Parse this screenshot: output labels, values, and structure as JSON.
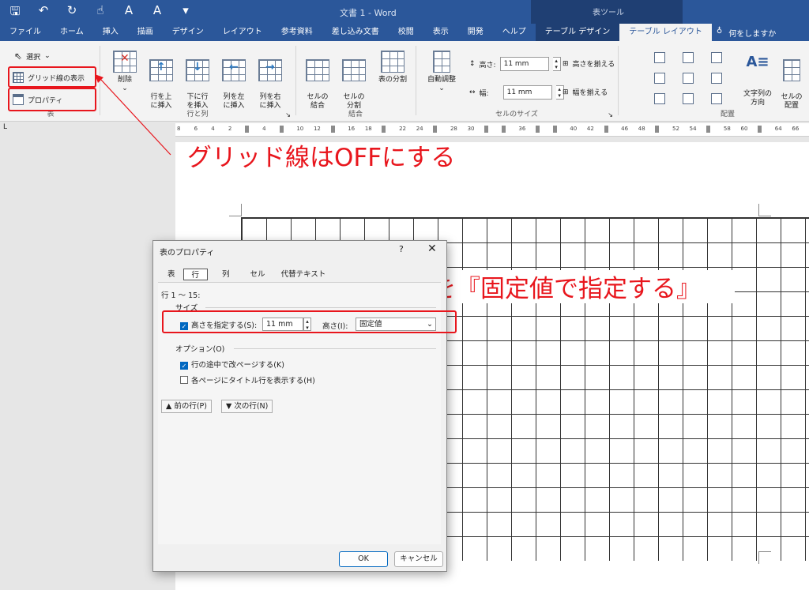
{
  "titlebar": {
    "qat": [
      "🖫",
      "↶",
      "↻",
      "☝",
      "A",
      "A",
      "▾"
    ],
    "doc_title": "文書 1  -  Word",
    "context_title": "表ツール"
  },
  "tabs": [
    {
      "label": "ファイル"
    },
    {
      "label": "ホーム"
    },
    {
      "label": "挿入"
    },
    {
      "label": "描画"
    },
    {
      "label": "デザイン"
    },
    {
      "label": "レイアウト"
    },
    {
      "label": "参考資料"
    },
    {
      "label": "差し込み文書"
    },
    {
      "label": "校閲"
    },
    {
      "label": "表示"
    },
    {
      "label": "開発"
    },
    {
      "label": "ヘルプ"
    },
    {
      "label": "テーブル デザイン"
    },
    {
      "label": "テーブル レイアウト"
    }
  ],
  "tell_me": {
    "icon": "lightbulb-icon",
    "label": "何をしますか"
  },
  "ribbon": {
    "table_group": {
      "select": "選択",
      "gridlines": "グリッド線の表示",
      "properties": "プロパティ",
      "label": "表"
    },
    "rows_cols": {
      "delete": "削除",
      "insert_above": "行を上\nに挿入",
      "insert_below": "下に行\nを挿入",
      "insert_left": "列を左\nに挿入",
      "insert_right": "列を右\nに挿入",
      "label": "行と列"
    },
    "merge": {
      "merge_cells": "セルの\n結合",
      "split_cells": "セルの\n分割",
      "split_table": "表の分割",
      "label": "結合"
    },
    "cell_size": {
      "autofit": "自動調整",
      "height_label": "高さ:",
      "height_value": "11 mm",
      "width_label": "幅:",
      "width_value": "11 mm",
      "distribute_rows": "高さを揃える",
      "distribute_cols": "幅を揃える",
      "label": "セルのサイズ"
    },
    "alignment": {
      "text_direction": "文字列の\n方向",
      "cell_margins": "セルの\n配置",
      "label": "配置"
    }
  },
  "ruler": {
    "corner": "L",
    "ticks": [
      "8",
      "6",
      "4",
      "2",
      "",
      "4",
      "",
      "10",
      "12",
      "",
      "16",
      "18",
      "",
      "22",
      "24",
      "",
      "28",
      "30",
      "",
      "",
      "36",
      "",
      "",
      "40",
      "42",
      "",
      "46",
      "48",
      "",
      "52",
      "54",
      "",
      "58",
      "60",
      "",
      "64",
      "66"
    ]
  },
  "annotations": {
    "gridlines_off": "グリッド線はOFFにする",
    "fixed_height": "高さを『固定値で指定する』"
  },
  "dialog": {
    "title": "表のプロパティ",
    "help": "?",
    "close": "✕",
    "tabs": [
      "表",
      "行",
      "列",
      "セル",
      "代替テキスト"
    ],
    "rows_range": "行 1 ～ 15:",
    "size_section": "サイズ",
    "specify_height": "高さを指定する(S):",
    "height_value": "11 mm",
    "height_rule_label": "高さ(I):",
    "height_rule_value": "固定値",
    "options_section": "オプション(O)",
    "allow_break": "行の途中で改ページする(K)",
    "repeat_header": "各ページにタイトル行を表示する(H)",
    "prev_row": "前の行(P)",
    "next_row": "次の行(N)",
    "ok": "OK",
    "cancel": "キャンセル"
  },
  "colors": {
    "word_blue": "#2b579a",
    "context_blue": "#1f3f73",
    "annotation_red": "#e8161d",
    "checkbox_blue": "#0067c0"
  }
}
